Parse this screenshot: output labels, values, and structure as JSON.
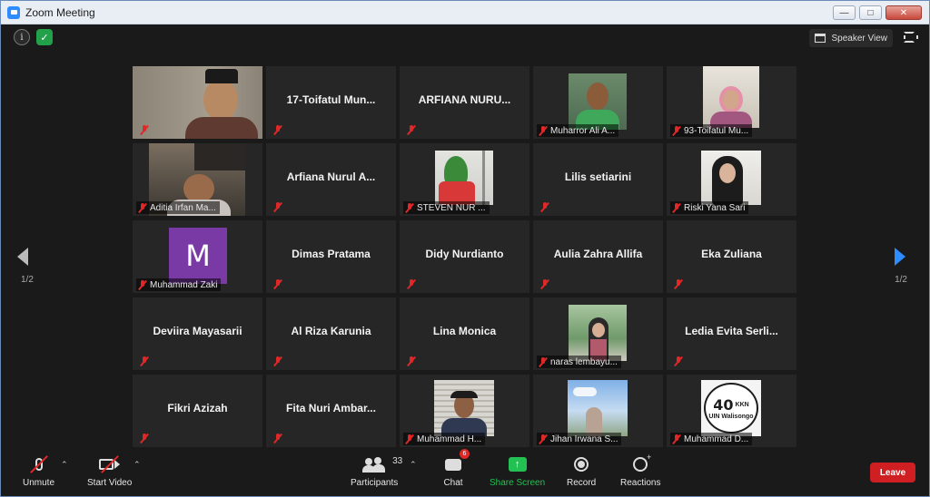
{
  "window": {
    "title": "Zoom Meeting"
  },
  "topbar": {
    "speaker_view_label": "Speaker View"
  },
  "pagination": {
    "left": "1/2",
    "right": "1/2"
  },
  "participants": [
    {
      "name": "",
      "video": "host",
      "label": ""
    },
    {
      "name": "17-Toifatul Mun...",
      "video": "none"
    },
    {
      "name": "ARFIANA NURU...",
      "video": "none"
    },
    {
      "name": "",
      "video": "man-green",
      "label": "Muharror Ali A..."
    },
    {
      "name": "",
      "video": "woman-hijab-pink",
      "label": "93-Toifatul Mu..."
    },
    {
      "name": "",
      "video": "man-dark",
      "label": "Aditia Irfan Ma..."
    },
    {
      "name": "Arfiana Nurul A...",
      "video": "none"
    },
    {
      "name": "",
      "video": "plant",
      "label": "STEVEN NUR ..."
    },
    {
      "name": "Lilis setiarini",
      "video": "none"
    },
    {
      "name": "",
      "video": "woman-hijab-black",
      "label": "Riski Yana Sari"
    },
    {
      "name": "",
      "video": "avatar-m",
      "label": "Muhammad Zaki",
      "avatar_letter": "M"
    },
    {
      "name": "Dimas Pratama",
      "video": "none"
    },
    {
      "name": "Didy Nurdianto",
      "video": "none"
    },
    {
      "name": "Aulia Zahra Allifa",
      "video": "none"
    },
    {
      "name": "Eka Zuliana",
      "video": "none"
    },
    {
      "name": "Deviira Mayasarii",
      "video": "none"
    },
    {
      "name": "Al Riza Karunia",
      "video": "none"
    },
    {
      "name": "Lina Monica",
      "video": "none"
    },
    {
      "name": "",
      "video": "woman-outdoor",
      "label": "naras lembayu..."
    },
    {
      "name": "Ledia  Evita  Serli...",
      "video": "none"
    },
    {
      "name": "Fikri Azizah",
      "video": "none"
    },
    {
      "name": "Fita Nuri Ambar...",
      "video": "none"
    },
    {
      "name": "",
      "video": "man-blinds",
      "label": "Muhammad H..."
    },
    {
      "name": "",
      "video": "woman-sky",
      "label": "Jihan Irwana S..."
    },
    {
      "name": "",
      "video": "kkn-logo",
      "label": "Muhammad D...",
      "logo_number": "40",
      "logo_tag": "KKN",
      "logo_text": "UIN Walisongo"
    }
  ],
  "toolbar": {
    "unmute": "Unmute",
    "start_video": "Start Video",
    "participants": "Participants",
    "participants_count": "33",
    "chat": "Chat",
    "chat_badge": "6",
    "share_screen": "Share Screen",
    "record": "Record",
    "reactions": "Reactions",
    "leave": "Leave"
  },
  "colors": {
    "accent": "#2d8cff",
    "active_speaker": "#d7e85a",
    "share": "#23c053",
    "leave": "#cf1f23",
    "muted": "#e02828"
  }
}
